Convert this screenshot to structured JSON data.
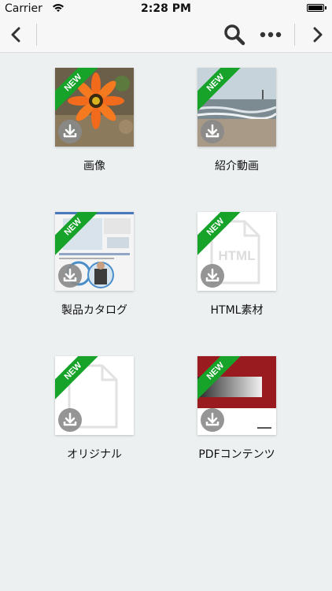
{
  "status_bar": {
    "carrier": "Carrier",
    "time": "2:28 PM"
  },
  "toolbar": {
    "back_icon": "chevron-left-icon",
    "search_icon": "search-icon",
    "more_icon": "ellipsis-icon",
    "forward_icon": "chevron-right-icon"
  },
  "badge_text": "NEW",
  "html_placeholder": "HTML",
  "tiles": [
    {
      "label": "画像",
      "badge": "NEW"
    },
    {
      "label": "紹介動画",
      "badge": "NEW"
    },
    {
      "label": "製品カタログ",
      "badge": "NEW"
    },
    {
      "label": "HTML素材",
      "badge": "NEW"
    },
    {
      "label": "オリジナル",
      "badge": "NEW"
    },
    {
      "label": "PDFコンテンツ",
      "badge": "NEW"
    }
  ],
  "colors": {
    "ribbon": "#17a22a",
    "background": "#ecf0f1",
    "toolbar": "#f7f7f7",
    "download_icon_bg": "#8a8a8a"
  }
}
